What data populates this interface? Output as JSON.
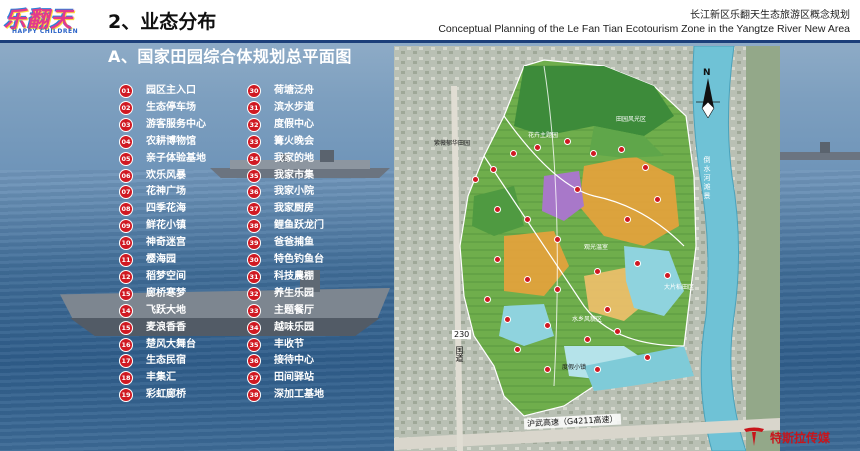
{
  "header": {
    "logo_text": "乐翻天",
    "logo_sub": "HAPPY CHILDREN",
    "section_title": "2、业态分布",
    "title_cn": "长江新区乐翻天生态旅游区概念规划",
    "title_en": "Conceptual Planning of the Le Fan Tian Ecotourism Zone in the Yangtze River New Area"
  },
  "subtitle": "A、国家田园综合体规划总平面图",
  "legend": {
    "left": [
      {
        "num": "01",
        "label": "园区主入口"
      },
      {
        "num": "02",
        "label": "生态停车场"
      },
      {
        "num": "03",
        "label": "游客服务中心"
      },
      {
        "num": "04",
        "label": "农耕博物馆"
      },
      {
        "num": "05",
        "label": "亲子体验基地"
      },
      {
        "num": "06",
        "label": "欢乐风暴"
      },
      {
        "num": "07",
        "label": "花神广场"
      },
      {
        "num": "08",
        "label": "四季花海"
      },
      {
        "num": "09",
        "label": "鲜花小镇"
      },
      {
        "num": "10",
        "label": "神奇迷宫"
      },
      {
        "num": "11",
        "label": "樱海园"
      },
      {
        "num": "12",
        "label": "稻梦空间"
      },
      {
        "num": "15",
        "label": "廊桥寒梦"
      },
      {
        "num": "14",
        "label": "飞跃大地"
      },
      {
        "num": "15",
        "label": "麦浪香香"
      },
      {
        "num": "16",
        "label": "楚风大舞台"
      },
      {
        "num": "17",
        "label": "生态民宿"
      },
      {
        "num": "18",
        "label": "丰集汇"
      },
      {
        "num": "19",
        "label": "彩虹廊桥"
      }
    ],
    "right": [
      {
        "num": "30",
        "label": "荷塘泛舟"
      },
      {
        "num": "31",
        "label": "滨水步道"
      },
      {
        "num": "32",
        "label": "度假中心"
      },
      {
        "num": "33",
        "label": "篝火晚会"
      },
      {
        "num": "34",
        "label": "我家的地"
      },
      {
        "num": "35",
        "label": "我家市集"
      },
      {
        "num": "36",
        "label": "我家小院"
      },
      {
        "num": "37",
        "label": "我家厨房"
      },
      {
        "num": "38",
        "label": "鲤鱼跃龙门"
      },
      {
        "num": "39",
        "label": "爸爸捕鱼"
      },
      {
        "num": "30",
        "label": "特色钓鱼台"
      },
      {
        "num": "31",
        "label": "科技農棚"
      },
      {
        "num": "32",
        "label": "养生乐园"
      },
      {
        "num": "33",
        "label": "主题餐厅"
      },
      {
        "num": "34",
        "label": "越味乐园"
      },
      {
        "num": "35",
        "label": "丰收节"
      },
      {
        "num": "36",
        "label": "接待中心"
      },
      {
        "num": "37",
        "label": "田间驿站"
      },
      {
        "num": "38",
        "label": "深加工基地"
      }
    ]
  },
  "map": {
    "label_top_left": "紫薇郁华田园",
    "label_cluster_1": "花卉主题园",
    "label_cluster_2": "田园风光区",
    "label_cluster_3": "观光温室",
    "label_cluster_4": "水乡风貌区",
    "label_cluster_5": "大片稻田区",
    "label_cluster_6": "度假小镇",
    "road_num": "230",
    "road_num_suffix": "国道",
    "highway_label": "沪武高速（G4211高速）",
    "river_label": "倒水河滩景",
    "compass_n": "N"
  },
  "brand": {
    "name": "特斯拉传媒",
    "mark": "TESLA"
  },
  "colors": {
    "legend_badge": "#d01922",
    "header_rule": "#1c3f7a",
    "brand": "#c8151b",
    "river": "#6fc2d6",
    "park_green": "#3d8b3a",
    "flower_orange": "#e8a23c",
    "flower_purple": "#a878c9"
  }
}
